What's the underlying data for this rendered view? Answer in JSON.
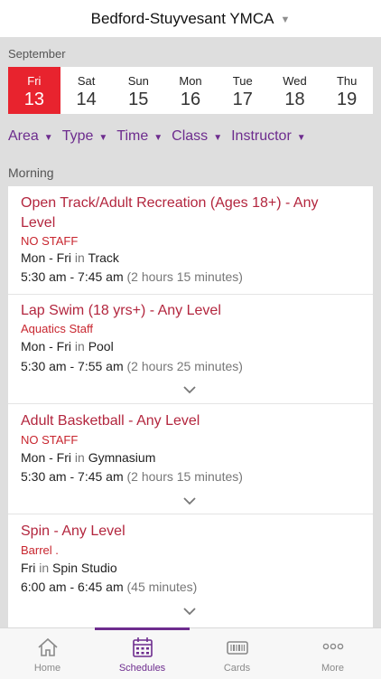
{
  "header": {
    "title": "Bedford-Stuyvesant YMCA",
    "caret": "▼"
  },
  "calendar": {
    "month": "September",
    "days": [
      {
        "name": "Fri",
        "num": "13"
      },
      {
        "name": "Sat",
        "num": "14"
      },
      {
        "name": "Sun",
        "num": "15"
      },
      {
        "name": "Mon",
        "num": "16"
      },
      {
        "name": "Tue",
        "num": "17"
      },
      {
        "name": "Wed",
        "num": "18"
      },
      {
        "name": "Thu",
        "num": "19"
      }
    ]
  },
  "filters": [
    {
      "label": "Area",
      "tri": "▼"
    },
    {
      "label": "Type",
      "tri": "▼"
    },
    {
      "label": "Time",
      "tri": "▼"
    },
    {
      "label": "Class",
      "tri": "▼"
    },
    {
      "label": "Instructor",
      "tri": "▼"
    }
  ],
  "section": "Morning",
  "classes": [
    {
      "name": "Open Track/Adult Recreation (Ages 18+) - Any Level",
      "staff": "NO STAFF",
      "days": "Mon - Fri",
      "in_word": "in",
      "location": "Track",
      "time": "5:30 am - 7:45 am",
      "duration": "(2 hours 15 minutes)"
    },
    {
      "name": "Lap Swim (18 yrs+) - Any Level",
      "staff": "Aquatics Staff",
      "days": "Mon - Fri",
      "in_word": "in",
      "location": "Pool",
      "time": "5:30 am - 7:55 am",
      "duration": "(2 hours 25 minutes)"
    },
    {
      "name": "Adult Basketball - Any Level",
      "staff": "NO STAFF",
      "days": "Mon - Fri",
      "in_word": "in",
      "location": "Gymnasium",
      "time": "5:30 am - 7:45 am",
      "duration": "(2 hours 15 minutes)"
    },
    {
      "name": "Spin - Any Level",
      "staff": "Barrel .",
      "days": "Fri",
      "in_word": "in",
      "location": "Spin Studio",
      "time": "6:00 am - 6:45 am",
      "duration": "(45 minutes)"
    }
  ],
  "tabs": [
    {
      "label": "Home",
      "icon": "home-icon"
    },
    {
      "label": "Schedules",
      "icon": "calendar-icon"
    },
    {
      "label": "Cards",
      "icon": "card-icon"
    },
    {
      "label": "More",
      "icon": "more-icon"
    }
  ],
  "colors": {
    "accent": "#6d2c8e",
    "selected": "#e8232e",
    "class_title": "#b3263e"
  }
}
